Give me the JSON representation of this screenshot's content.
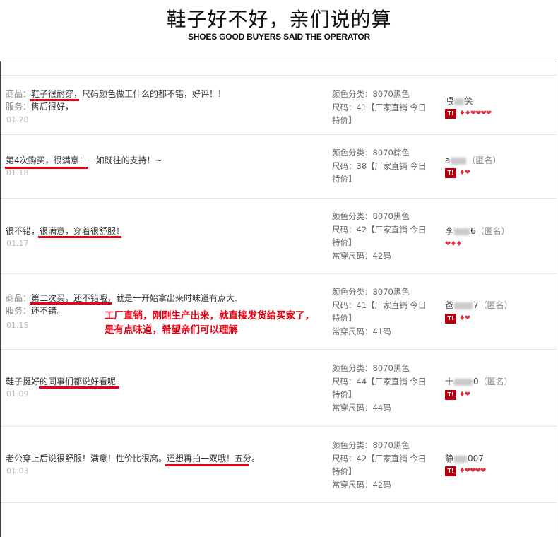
{
  "header": {
    "title_cn": "鞋子好不好，亲们说的算",
    "title_en": "SHOES GOOD BUYERS SAID THE OPERATOR"
  },
  "annotation": {
    "line1": "工厂直销，刚刚生产出来，就直接发货给买家了，",
    "line2": "是有点味道，希望亲们可以理解"
  },
  "colors": {
    "accent": "#e60012",
    "badge": "#b3000f"
  },
  "reviews": [
    {
      "product_label": "商品：",
      "text": "鞋子很耐穿，尺码颜色做工什么的都不错，好评！！",
      "service_label": "服务：",
      "service_text": "售后很好，",
      "date": "01.28",
      "color": "颜色分类：8070黑色",
      "size": "尺码：41【厂家直销 今日特价】",
      "usual": "",
      "user_a": "喂",
      "user_b": "笑",
      "anon": ""
    },
    {
      "text": "第4次购买，很满意！一如既往的支持！~",
      "date": "01.18",
      "color": "颜色分类：8070棕色",
      "size": "尺码：38【厂家直销 今日特价】",
      "usual": "",
      "user_a": "a",
      "user_b": "",
      "anon": "（匿名）"
    },
    {
      "text": "很不错，很满意，穿着很舒服！",
      "date": "01.17",
      "color": "颜色分类：8070黑色",
      "size": "尺码：42【厂家直销 今日特价】",
      "usual": "常穿尺码：42码",
      "user_a": "李",
      "user_b": "6",
      "anon": "（匿名）"
    },
    {
      "product_label": "商品：",
      "text": "第二次买，还不错哦，就是一开始拿出来时味道有点大.",
      "service_label": "服务：",
      "service_text": "还不错。",
      "date": "01.15",
      "color": "颜色分类：8070黑色",
      "size": "尺码：41【厂家直销 今日特价】",
      "usual": "常穿尺码：41码",
      "user_a": "爸",
      "user_b": "7",
      "anon": "（匿名）"
    },
    {
      "text": "鞋子挺好的同事们都说好看呢",
      "date": "01.09",
      "color": "颜色分类：8070黑色",
      "size": "尺码：44【厂家直销 今日特价】",
      "usual": "常穿尺码：44码",
      "user_a": "十",
      "user_b": "0",
      "anon": "（匿名）"
    },
    {
      "text": "老公穿上后说很舒服！满意！性价比很高。还想再拍一双哦！五分。",
      "date": "01.03",
      "color": "颜色分类：8070黑色",
      "size": "尺码：42【厂家直销 今日特价】",
      "usual": "常穿尺码：42码",
      "user_a": "静",
      "user_b": "007",
      "anon": ""
    }
  ]
}
